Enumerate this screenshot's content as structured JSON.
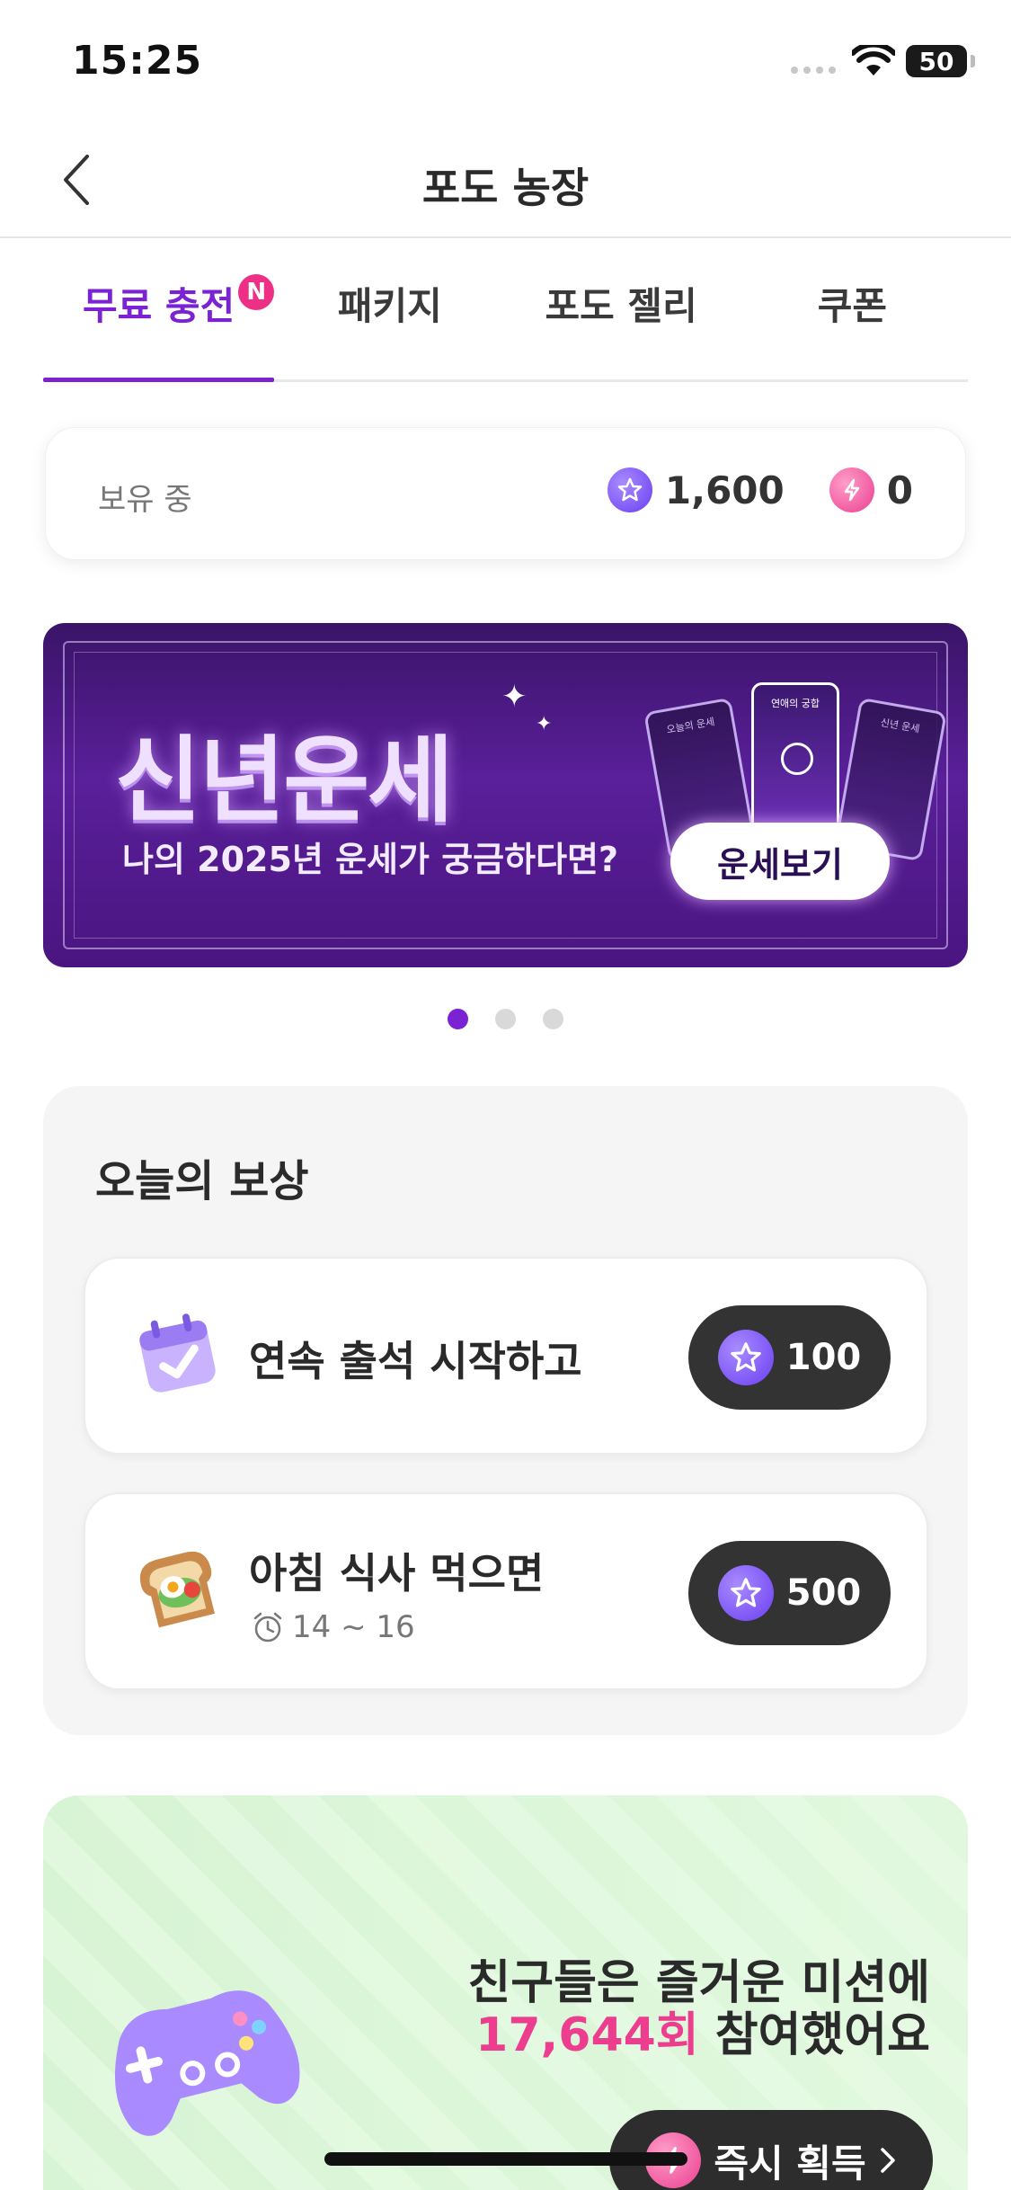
{
  "status_bar": {
    "time": "15:25",
    "battery": "50"
  },
  "nav": {
    "title": "포도 농장"
  },
  "tabs": [
    {
      "label": "무료 충전",
      "badge": "N",
      "active": true
    },
    {
      "label": "패키지"
    },
    {
      "label": "포도 젤리"
    },
    {
      "label": "쿠폰"
    }
  ],
  "balance": {
    "label": "보유 중",
    "grape_points": "1,600",
    "jelly_points": "0"
  },
  "banner": {
    "title": "신년운세",
    "subtitle": "나의 2025년 운세가 궁금하다면?",
    "button": "운세보기",
    "card_labels": [
      "오늘의 운세",
      "연애의 궁합",
      "신년 운세"
    ],
    "page_count": 3,
    "active_page": 1
  },
  "rewards": {
    "title": "오늘의 보상",
    "items": [
      {
        "label": "연속 출석 시작하고",
        "amount": "100",
        "icon": "calendar-check-icon"
      },
      {
        "label": "아침 식사 먹으면",
        "time": "14 ~ 16",
        "amount": "500",
        "icon": "toast-icon"
      }
    ]
  },
  "mission": {
    "line1": "친구들은 즐거운 미션에",
    "count": "17,644회",
    "line2_suffix": " 참여했어요",
    "button": "즉시 획득"
  },
  "colors": {
    "accent": "#7b22d3",
    "badge": "#ee2f86",
    "pill": "#333333"
  }
}
